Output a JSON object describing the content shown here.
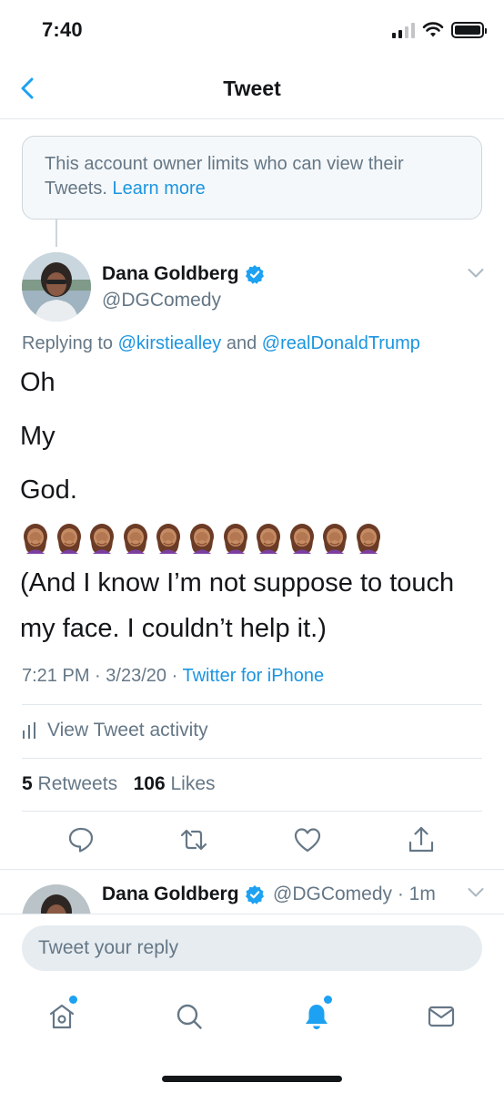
{
  "status_bar": {
    "time": "7:40"
  },
  "header": {
    "title": "Tweet"
  },
  "notice": {
    "text": "This account owner limits who can view their Tweets.",
    "link": "Learn more"
  },
  "tweet": {
    "author_name": "Dana Goldberg",
    "author_handle": "@DGComedy",
    "replying_prefix": "Replying to",
    "replying_to_1": "@kirstiealley",
    "replying_and": "and",
    "replying_to_2": "@realDonaldTrump",
    "lines": [
      "Oh",
      "My",
      "God."
    ],
    "emoji_icon": "woman-facepalming-emoji",
    "emoji_count": 11,
    "closing_line_1": "(And I know I’m not suppose to touch",
    "closing_line_2": "my face. I couldn’t help it.)",
    "time": "7:21 PM",
    "date": "3/23/20",
    "separator": "·",
    "source": "Twitter for iPhone",
    "activity_label": "View Tweet activity",
    "retweets_count": "5",
    "retweets_label": "Retweets",
    "likes_count": "106",
    "likes_label": "Likes"
  },
  "actions": [
    {
      "name": "reply",
      "icon": "reply-icon"
    },
    {
      "name": "retweet",
      "icon": "retweet-icon"
    },
    {
      "name": "like",
      "icon": "heart-icon"
    },
    {
      "name": "share",
      "icon": "share-icon"
    }
  ],
  "next_tweet": {
    "author_name": "Dana Goldberg",
    "handle_time": "@DGComedy · 1m"
  },
  "compose": {
    "placeholder": "Tweet your reply"
  },
  "tabs": [
    {
      "name": "home",
      "icon": "home-icon",
      "badge": true
    },
    {
      "name": "search",
      "icon": "search-icon",
      "badge": false
    },
    {
      "name": "notifications",
      "icon": "bell-icon",
      "badge": true,
      "active": true
    },
    {
      "name": "messages",
      "icon": "mail-icon",
      "badge": false
    }
  ],
  "colors": {
    "accent": "#1da1f2",
    "link": "#1b95e0",
    "text_primary": "#14171a",
    "text_secondary": "#657786",
    "divider": "#e1e8ed"
  }
}
